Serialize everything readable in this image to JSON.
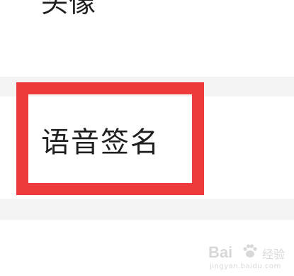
{
  "settings": {
    "rows": [
      {
        "label": "头像"
      },
      {
        "label": "语音签名"
      }
    ]
  },
  "highlight": {
    "color": "#ee3a3a"
  },
  "watermark": {
    "logo_text": "Bai",
    "logo_suffix": "经验",
    "url": "jingyan.baidu.com"
  }
}
